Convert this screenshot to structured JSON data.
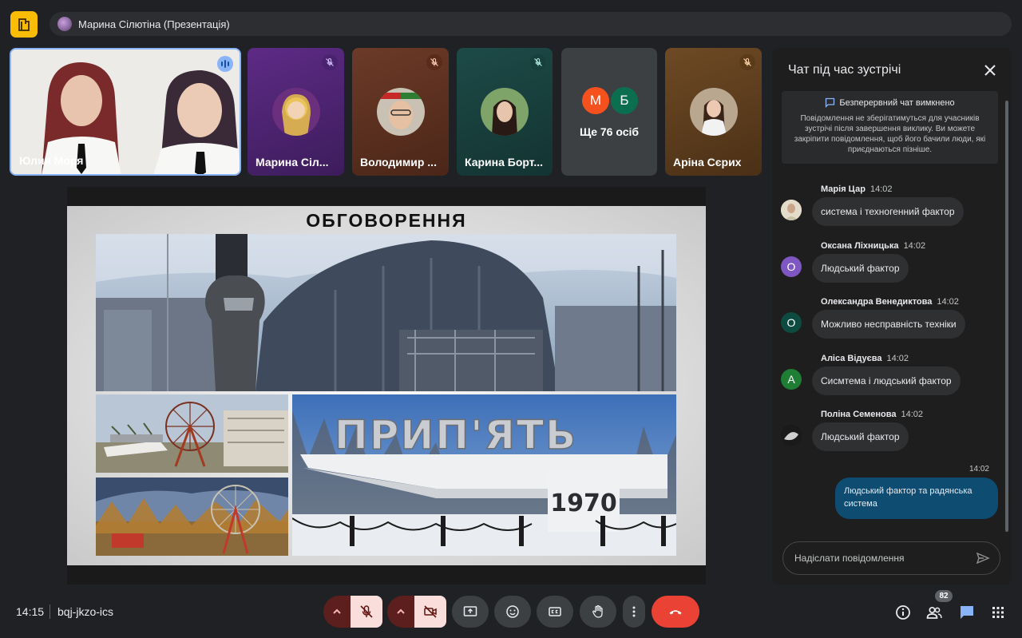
{
  "header": {
    "presenter_label": "Марина Сілютіна (Презентація)"
  },
  "tiles": {
    "video": {
      "name": "Юлия Моря"
    },
    "t1": {
      "name": "Марина Сіл..."
    },
    "t2": {
      "name": "Володимир ..."
    },
    "t3": {
      "name": "Карина Борт..."
    },
    "more": {
      "initial_1": "М",
      "initial_2": "Б",
      "label": "Ще 76 осіб"
    },
    "t5": {
      "name": "Аріна Сєрих"
    }
  },
  "slide": {
    "title": "ОБГОВОРЕННЯ",
    "sign_text": "ПРИП'ЯТЬ",
    "sign_year": "1970"
  },
  "chat": {
    "title": "Чат під час зустрічі",
    "notice_head": "Безперервний чат вимкнено",
    "notice_body": "Повідомлення не зберігатимуться для учасників зустрічі після завершення виклику. Ви можете закріпити повідомлення, щоб його бачили люди, які приєднаються пізніше.",
    "messages": [
      {
        "sender": "Марія Цар",
        "time": "14:02",
        "text": "система і техногенний фактор",
        "avatar_letter": ""
      },
      {
        "sender": "Оксана Ліхницька",
        "time": "14:02",
        "text": "Людський фактор",
        "avatar_letter": "О"
      },
      {
        "sender": "Олександра Венедиктова",
        "time": "14:02",
        "text": "Можливо несправність техніки",
        "avatar_letter": "О"
      },
      {
        "sender": "Аліса Відуєва",
        "time": "14:02",
        "text": "Сисмтема і людський фактор",
        "avatar_letter": "А"
      },
      {
        "sender": "Поліна Семенова",
        "time": "14:02",
        "text": "Людський фактор",
        "avatar_letter": ""
      }
    ],
    "own_time": "14:02",
    "own_text": "Людський фактор та радянська система",
    "input_placeholder": "Надіслати повідомлення"
  },
  "footer": {
    "clock": "14:15",
    "meeting_code": "bqj-jkzo-ics",
    "people_count": "82"
  },
  "colors": {
    "accent_blue": "#8ab4f8",
    "hangup_red": "#ea4335",
    "logo_yellow": "#fbbc04"
  }
}
